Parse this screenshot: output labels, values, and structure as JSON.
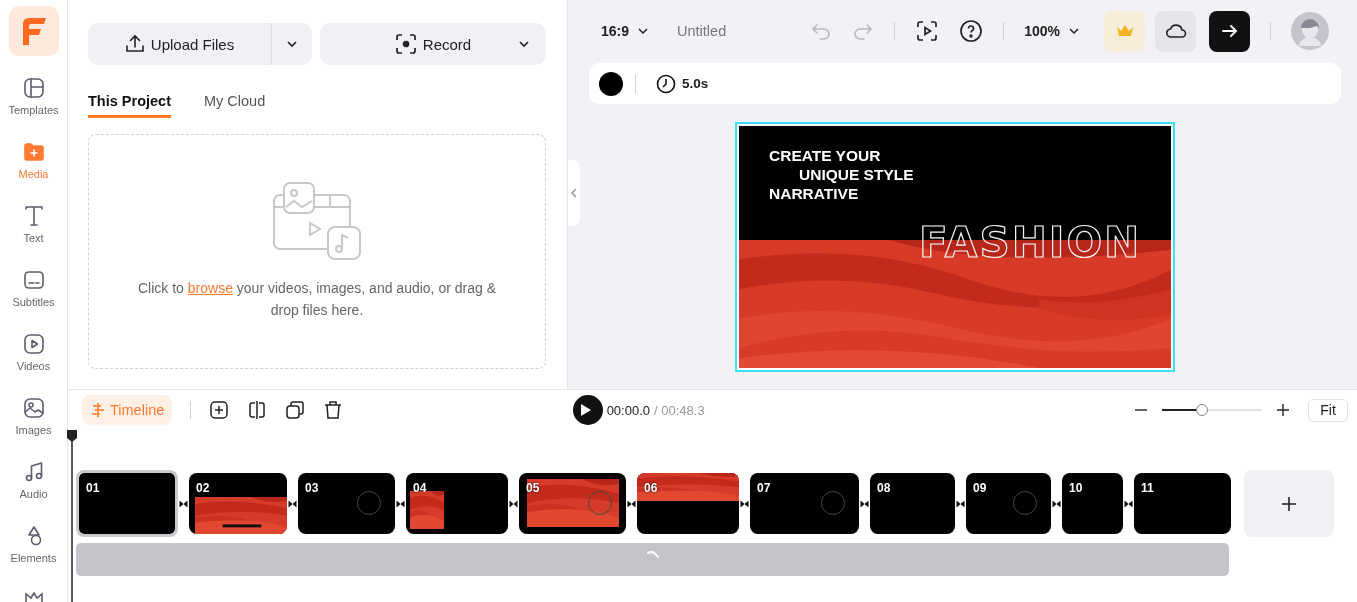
{
  "sidebar": {
    "items": [
      {
        "label": "Templates",
        "selected": false
      },
      {
        "label": "Media",
        "selected": true
      },
      {
        "label": "Text",
        "selected": false
      },
      {
        "label": "Subtitles",
        "selected": false
      },
      {
        "label": "Videos",
        "selected": false
      },
      {
        "label": "Images",
        "selected": false
      },
      {
        "label": "Audio",
        "selected": false
      },
      {
        "label": "Elements",
        "selected": false
      }
    ]
  },
  "media_panel": {
    "upload_button": "Upload Files",
    "record_button": "Record",
    "tabs": [
      {
        "label": "This Project",
        "selected": true
      },
      {
        "label": "My Cloud",
        "selected": false
      }
    ],
    "drop_zone": {
      "text_before": "Click to",
      "link": "browse",
      "text_after": "your videos, images, and audio, or drag & drop files here."
    }
  },
  "top_bar": {
    "aspect_ratio": "16:9",
    "title": "Untitled",
    "undo": {
      "disabled": true
    },
    "redo": {
      "disabled": true
    },
    "zoom": "100%"
  },
  "slide_bar": {
    "duration": "5.0s"
  },
  "canvas": {
    "selected": true,
    "headline": [
      {
        "text": "CREATE YOUR",
        "indented": false
      },
      {
        "text": "UNIQUE STYLE",
        "indented": true
      },
      {
        "text": "NARRATIVE",
        "indented": false
      }
    ],
    "title": "FASHION"
  },
  "timeline": {
    "mode_button": "Timeline",
    "current_time": "00:00.0",
    "total_time": "/ 00:48.3",
    "zoom": {
      "level": 0.39
    },
    "fit_button": "Fit",
    "clips": [
      {
        "label": "01",
        "selected": true,
        "kind": "black"
      },
      {
        "label": "02",
        "selected": false,
        "kind": "redbottom"
      },
      {
        "label": "03",
        "selected": false,
        "kind": "circle"
      },
      {
        "label": "04",
        "selected": false,
        "kind": "redsquare"
      },
      {
        "label": "05",
        "selected": false,
        "kind": "redfull"
      },
      {
        "label": "06",
        "selected": false,
        "kind": "redtop"
      },
      {
        "label": "07",
        "selected": false,
        "kind": "circle"
      },
      {
        "label": "08",
        "selected": false,
        "kind": "black"
      },
      {
        "label": "09",
        "selected": false,
        "kind": "circle"
      },
      {
        "label": "10",
        "selected": false,
        "kind": "black"
      },
      {
        "label": "11",
        "selected": false,
        "kind": "black"
      }
    ],
    "audio_track": {
      "loading": true
    }
  }
}
